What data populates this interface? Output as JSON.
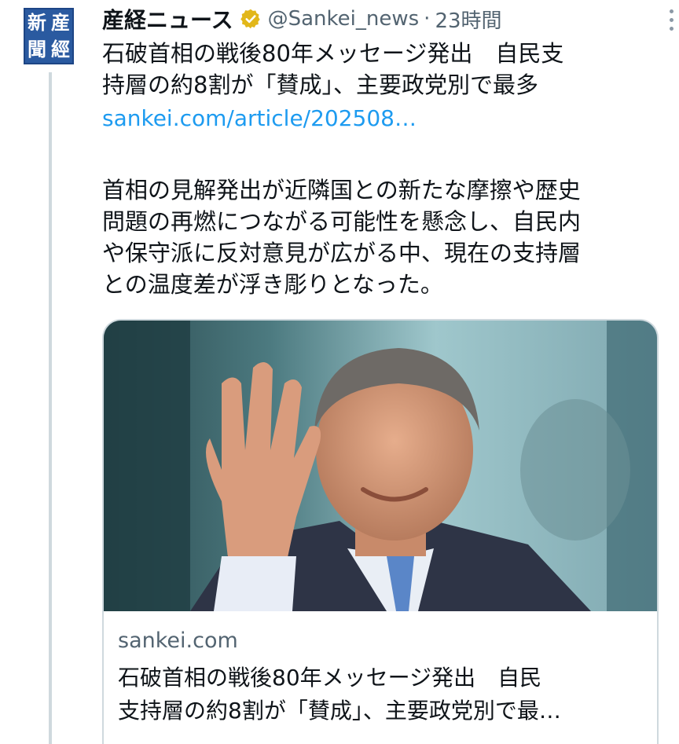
{
  "tweet": {
    "author": {
      "name": "産経ニュース",
      "handle": "@Sankei_news",
      "separator": "·",
      "time": "23時間",
      "avatar_chars": [
        "新",
        "産",
        "聞",
        "經"
      ]
    },
    "text_lines": [
      "石破首相の戦後80年メッセージ発出　自民支",
      "持層の約8割が「賛成」、主要政党別で最多"
    ],
    "link": "sankei.com/article/202508…",
    "body_lines": [
      "首相の見解発出が近隣国との新たな摩擦や歴史",
      "問題の再燃につながる可能性を懸念し、自民内",
      "や保守派に反対意見が広がる中、現在の支持層",
      "との温度差が浮き彫りとなった。"
    ],
    "card": {
      "domain": "sankei.com",
      "title_lines": [
        "石破首相の戦後80年メッセージ発出　自民",
        "支持層の約8割が「賛成」、主要政党別で最…"
      ]
    }
  },
  "colors": {
    "verified": "#e2b719",
    "link": "#1d9bf0",
    "secondary_text": "#536471",
    "avatar": "#2a5aa0"
  },
  "icons": {
    "verified": "verified-badge-icon",
    "more": "more-options-icon"
  }
}
